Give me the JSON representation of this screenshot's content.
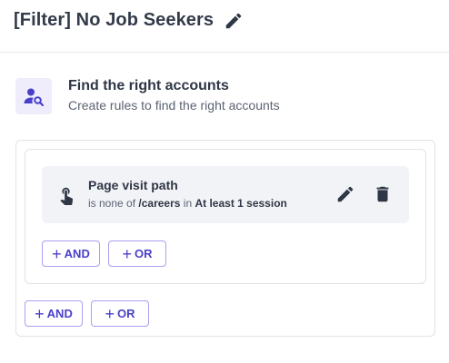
{
  "header": {
    "title": "[Filter] No Job Seekers",
    "edit_icon": "pencil-icon"
  },
  "section": {
    "icon": "user-search-icon",
    "title": "Find the right accounts",
    "subtitle": "Create rules to find the right accounts"
  },
  "rule": {
    "icon": "pointer-hand-icon",
    "title": "Page visit path",
    "desc_prefix": "is none of",
    "desc_value": "/careers",
    "desc_mid": "in",
    "desc_scope": "At least 1 session",
    "edit_icon": "pencil-icon",
    "delete_icon": "trash-icon"
  },
  "inner_buttons": {
    "and_label": "AND",
    "or_label": "OR"
  },
  "outer_buttons": {
    "and_label": "AND",
    "or_label": "OR"
  },
  "colors": {
    "accent": "#4a3fc9",
    "accent_border": "#a99ff0",
    "icon_bg": "#efedfb",
    "rule_bg": "#f2f3f6"
  }
}
